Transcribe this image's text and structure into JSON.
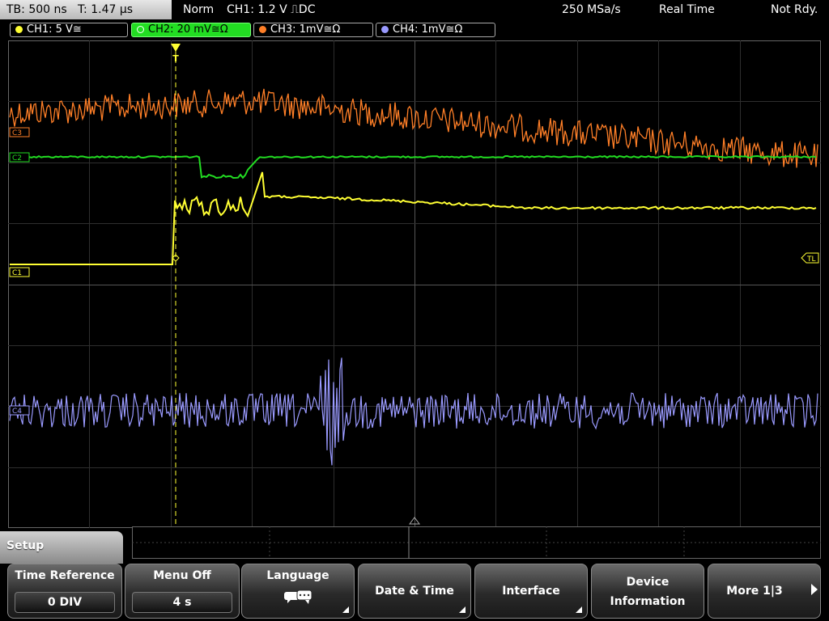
{
  "status": {
    "timebase": "TB: 500 ns",
    "trigger_time": "T: 1.47 µs",
    "trigger_mode": "Norm",
    "trigger_setting": "CH1: 1.2 V ⎍DC",
    "sample_rate": "250 MSa/s",
    "acq_mode": "Real Time",
    "state": "Not Rdy."
  },
  "channels": [
    {
      "label": "CH1: 5 V≅",
      "color": "#ffff33"
    },
    {
      "label": "CH2: 20 mV≅Ω",
      "color": "#22dd22"
    },
    {
      "label": "CH3: 1mV≅Ω",
      "color": "#ff7f27"
    },
    {
      "label": "CH4: 1mV≅Ω",
      "color": "#9a9aff"
    }
  ],
  "markers": {
    "ch3": "C3",
    "ch2": "C2",
    "ch1": "C1",
    "ch4": "C4",
    "trigger_level": "TL",
    "trigger_pos": "T"
  },
  "menu": {
    "title": "Setup",
    "time_reference": {
      "label": "Time Reference",
      "value": "0 DIV"
    },
    "menu_off": {
      "label": "Menu Off",
      "value": "4 s"
    },
    "language": {
      "label": "Language",
      "icon": "speech-bubbles-icon"
    },
    "date_time": {
      "label": "Date & Time"
    },
    "interface": {
      "label": "Interface"
    },
    "device_information": {
      "label1": "Device",
      "label2": "Information"
    },
    "more": {
      "label": "More 1|3",
      "icon": "arrow-right-icon"
    }
  }
}
